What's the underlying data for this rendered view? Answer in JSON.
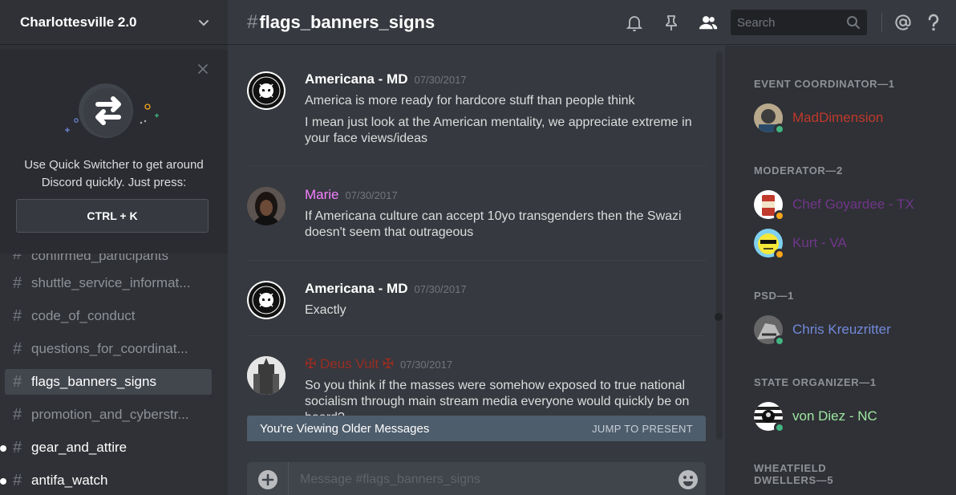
{
  "server": {
    "name": "Charlottesville 2.0"
  },
  "quick_switcher": {
    "text": "Use Quick Switcher to get around Discord quickly. Just press:",
    "shortcut": "CTRL + K"
  },
  "channels": [
    {
      "name": "confirmed_participants",
      "state": "partial"
    },
    {
      "name": "shuttle_service_informat...",
      "state": "normal"
    },
    {
      "name": "code_of_conduct",
      "state": "normal"
    },
    {
      "name": "questions_for_coordinat...",
      "state": "normal"
    },
    {
      "name": "flags_banners_signs",
      "state": "active"
    },
    {
      "name": "promotion_and_cyberstr...",
      "state": "normal"
    },
    {
      "name": "gear_and_attire",
      "state": "unread"
    },
    {
      "name": "antifa_watch",
      "state": "unread"
    }
  ],
  "header": {
    "hash": "#",
    "channel": "flags_banners_signs",
    "search_placeholder": "Search",
    "icons": [
      "bell-icon",
      "pin-icon",
      "members-icon",
      "search-icon",
      "mention-icon",
      "help-icon"
    ]
  },
  "messages": [
    {
      "author": "Americana - MD",
      "author_color": "#ffffff",
      "timestamp": "07/30/2017",
      "lines": [
        "America is more ready for hardcore stuff than people think",
        "I mean just look at the American mentality, we appreciate extreme in your face views/ideas"
      ]
    },
    {
      "author": "Marie",
      "author_color": "#f47fff",
      "timestamp": "07/30/2017",
      "lines": [
        "If Americana culture can accept 10yo transgenders then the Swazi doesn't seem that outrageous"
      ]
    },
    {
      "author": "Americana - MD",
      "author_color": "#ffffff",
      "timestamp": "07/30/2017",
      "lines": [
        "Exactly"
      ]
    },
    {
      "author": "✠ Deus Vult ✠",
      "author_color": "#992d22",
      "timestamp": "07/30/2017",
      "lines": [
        "So you think if the masses were somehow exposed to true national socialism through main stream media everyone would quickly be on board?"
      ]
    }
  ],
  "older_bar": {
    "text": "You're Viewing Older Messages",
    "jump": "JUMP TO PRESENT"
  },
  "composer": {
    "placeholder": "Message #flags_banners_signs"
  },
  "roles": [
    {
      "title": "EVENT COORDINATOR—1",
      "members": [
        {
          "name": "MadDimension",
          "color": "#c0392b",
          "status": "#43b581"
        }
      ]
    },
    {
      "title": "MODERATOR—2",
      "members": [
        {
          "name": "Chef Goyardee - TX",
          "color": "#71368a",
          "status": "#faa61a"
        },
        {
          "name": "Kurt - VA",
          "color": "#71368a",
          "status": "#faa61a"
        }
      ]
    },
    {
      "title": "PSD—1",
      "members": [
        {
          "name": "Chris Kreuzritter",
          "color": "#7289da",
          "status": "#43b581"
        }
      ]
    },
    {
      "title": "STATE ORGANIZER—1",
      "members": [
        {
          "name": "von Diez - NC",
          "color": "#9ee6a1",
          "status": "#43b581"
        }
      ]
    },
    {
      "title": "WHEATFIELD DWELLERS—5",
      "members": []
    }
  ],
  "colors": {
    "background": "#36393f",
    "sidebar": "#2f3136",
    "accent": "#7289da"
  }
}
